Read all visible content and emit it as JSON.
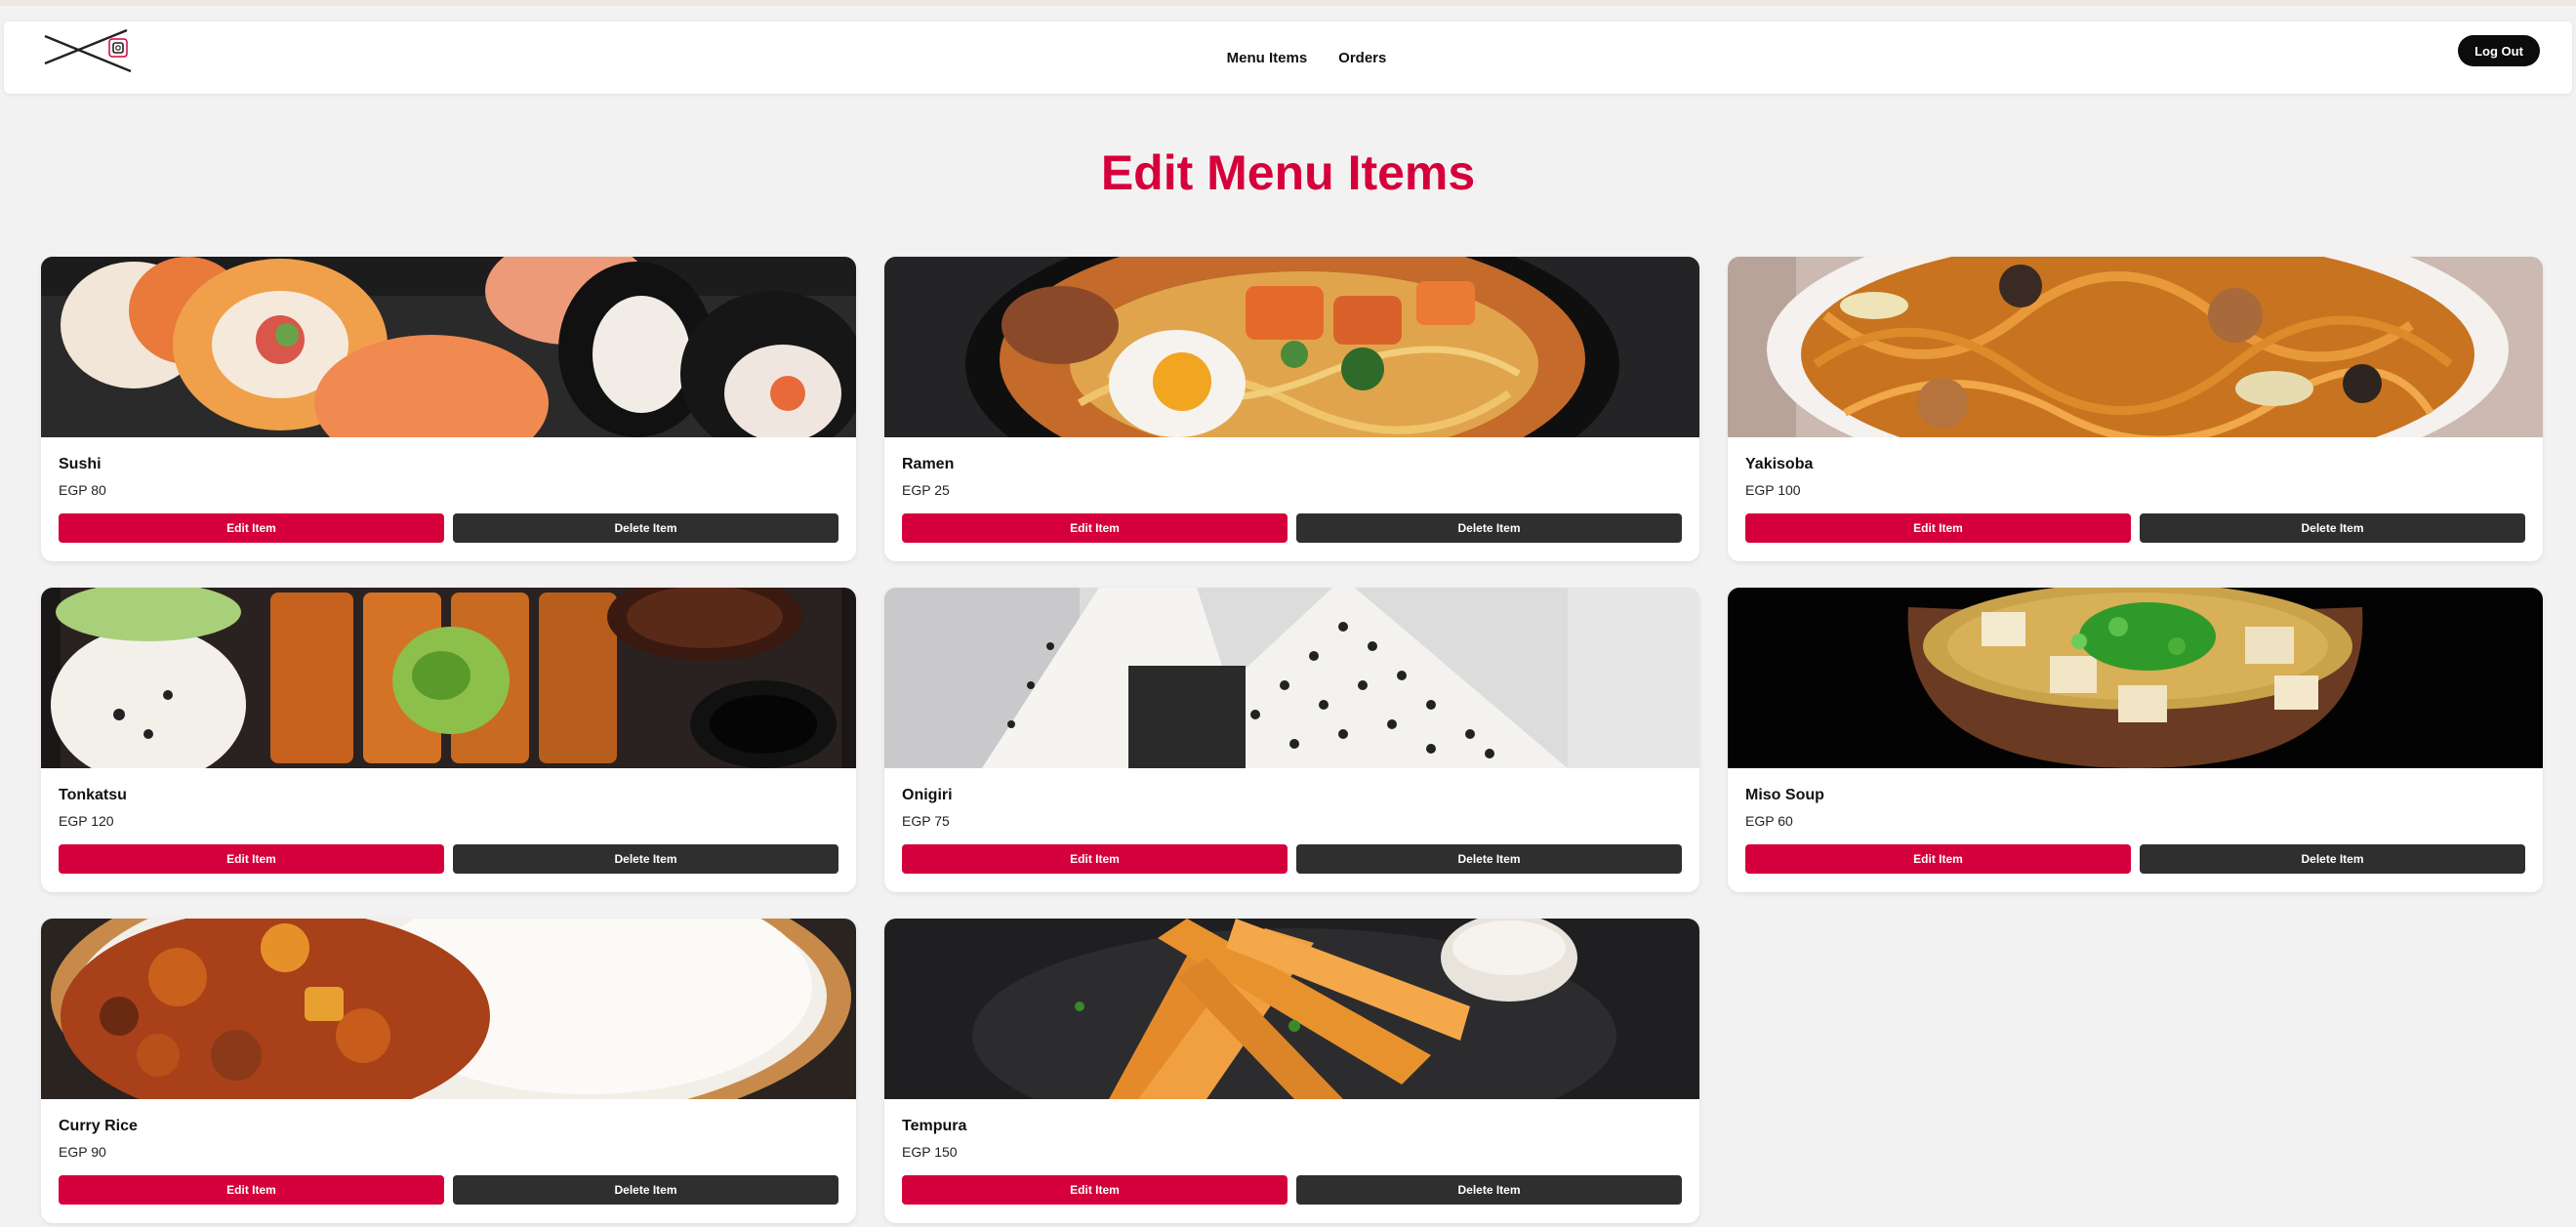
{
  "nav": {
    "links": [
      "Menu Items",
      "Orders"
    ],
    "logout_label": "Log Out"
  },
  "page": {
    "title": "Edit Menu Items"
  },
  "menu_items": [
    {
      "name": "Sushi",
      "price": "EGP 80",
      "edit_label": "Edit Item",
      "delete_label": "Delete Item"
    },
    {
      "name": "Ramen",
      "price": "EGP 25",
      "edit_label": "Edit Item",
      "delete_label": "Delete Item"
    },
    {
      "name": "Yakisoba",
      "price": "EGP 100",
      "edit_label": "Edit Item",
      "delete_label": "Delete Item"
    },
    {
      "name": "Tonkatsu",
      "price": "EGP 120",
      "edit_label": "Edit Item",
      "delete_label": "Delete Item"
    },
    {
      "name": "Onigiri",
      "price": "EGP 75",
      "edit_label": "Edit Item",
      "delete_label": "Delete Item"
    },
    {
      "name": "Miso Soup",
      "price": "EGP 60",
      "edit_label": "Edit Item",
      "delete_label": "Delete Item"
    },
    {
      "name": "Curry Rice",
      "price": "EGP 90",
      "edit_label": "Edit Item",
      "delete_label": "Delete Item"
    },
    {
      "name": "Tempura",
      "price": "EGP 150",
      "edit_label": "Edit Item",
      "delete_label": "Delete Item"
    }
  ],
  "colors": {
    "accent": "#d5003b",
    "delete_button": "#2f2f2f",
    "logout_button": "#0c0c0c",
    "page_background": "#f3f2f2"
  }
}
